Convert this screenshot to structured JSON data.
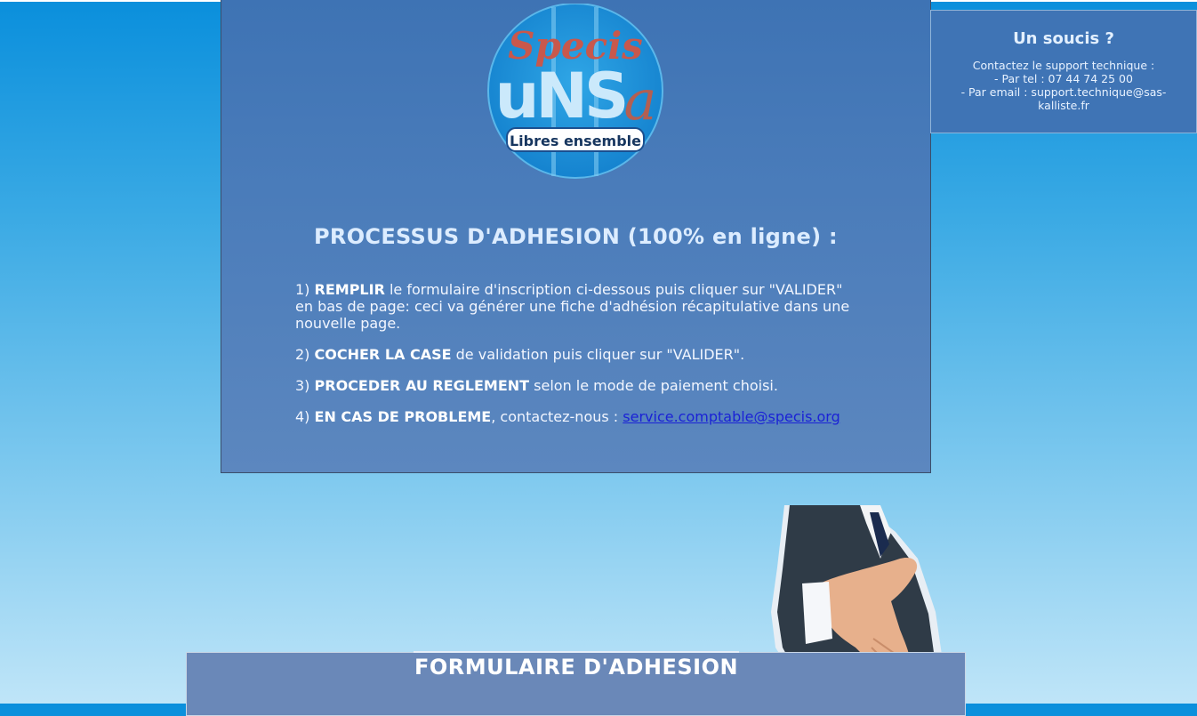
{
  "logo": {
    "brand_top": "Specis",
    "brand_mid": "unsa",
    "tagline": "Libres ensemble"
  },
  "process": {
    "title": "PROCESSUS D'ADHESION (100% en ligne) :",
    "steps": [
      {
        "num": "1)",
        "bold": "REMPLIR",
        "text": " le formulaire d'inscription ci-dessous puis cliquer sur \"VALIDER\" en bas de page: ceci va générer une fiche d'adhésion récapitulative dans une nouvelle page."
      },
      {
        "num": "2)",
        "bold": "COCHER LA CASE",
        "text": " de validation puis cliquer sur \"VALIDER\"."
      },
      {
        "num": "3)",
        "bold": "PROCEDER AU REGLEMENT",
        "text": " selon le mode de paiement choisi."
      },
      {
        "num": "4)",
        "bold": "EN CAS DE PROBLEME",
        "text": ", contactez-nous : ",
        "link": "service.comptable@specis.org"
      }
    ]
  },
  "help": {
    "title": "Un soucis ?",
    "line1": "Contactez le support technique :",
    "line2": "- Par tel : 07 44 74 25 00",
    "line3": "- Par email : support.technique@sas-kalliste.fr"
  },
  "form": {
    "title": "FORMULAIRE D'ADHESION"
  },
  "colors": {
    "panel": "#4a7cba",
    "link": "#1a22d6",
    "form_panel": "#6a88b8"
  }
}
